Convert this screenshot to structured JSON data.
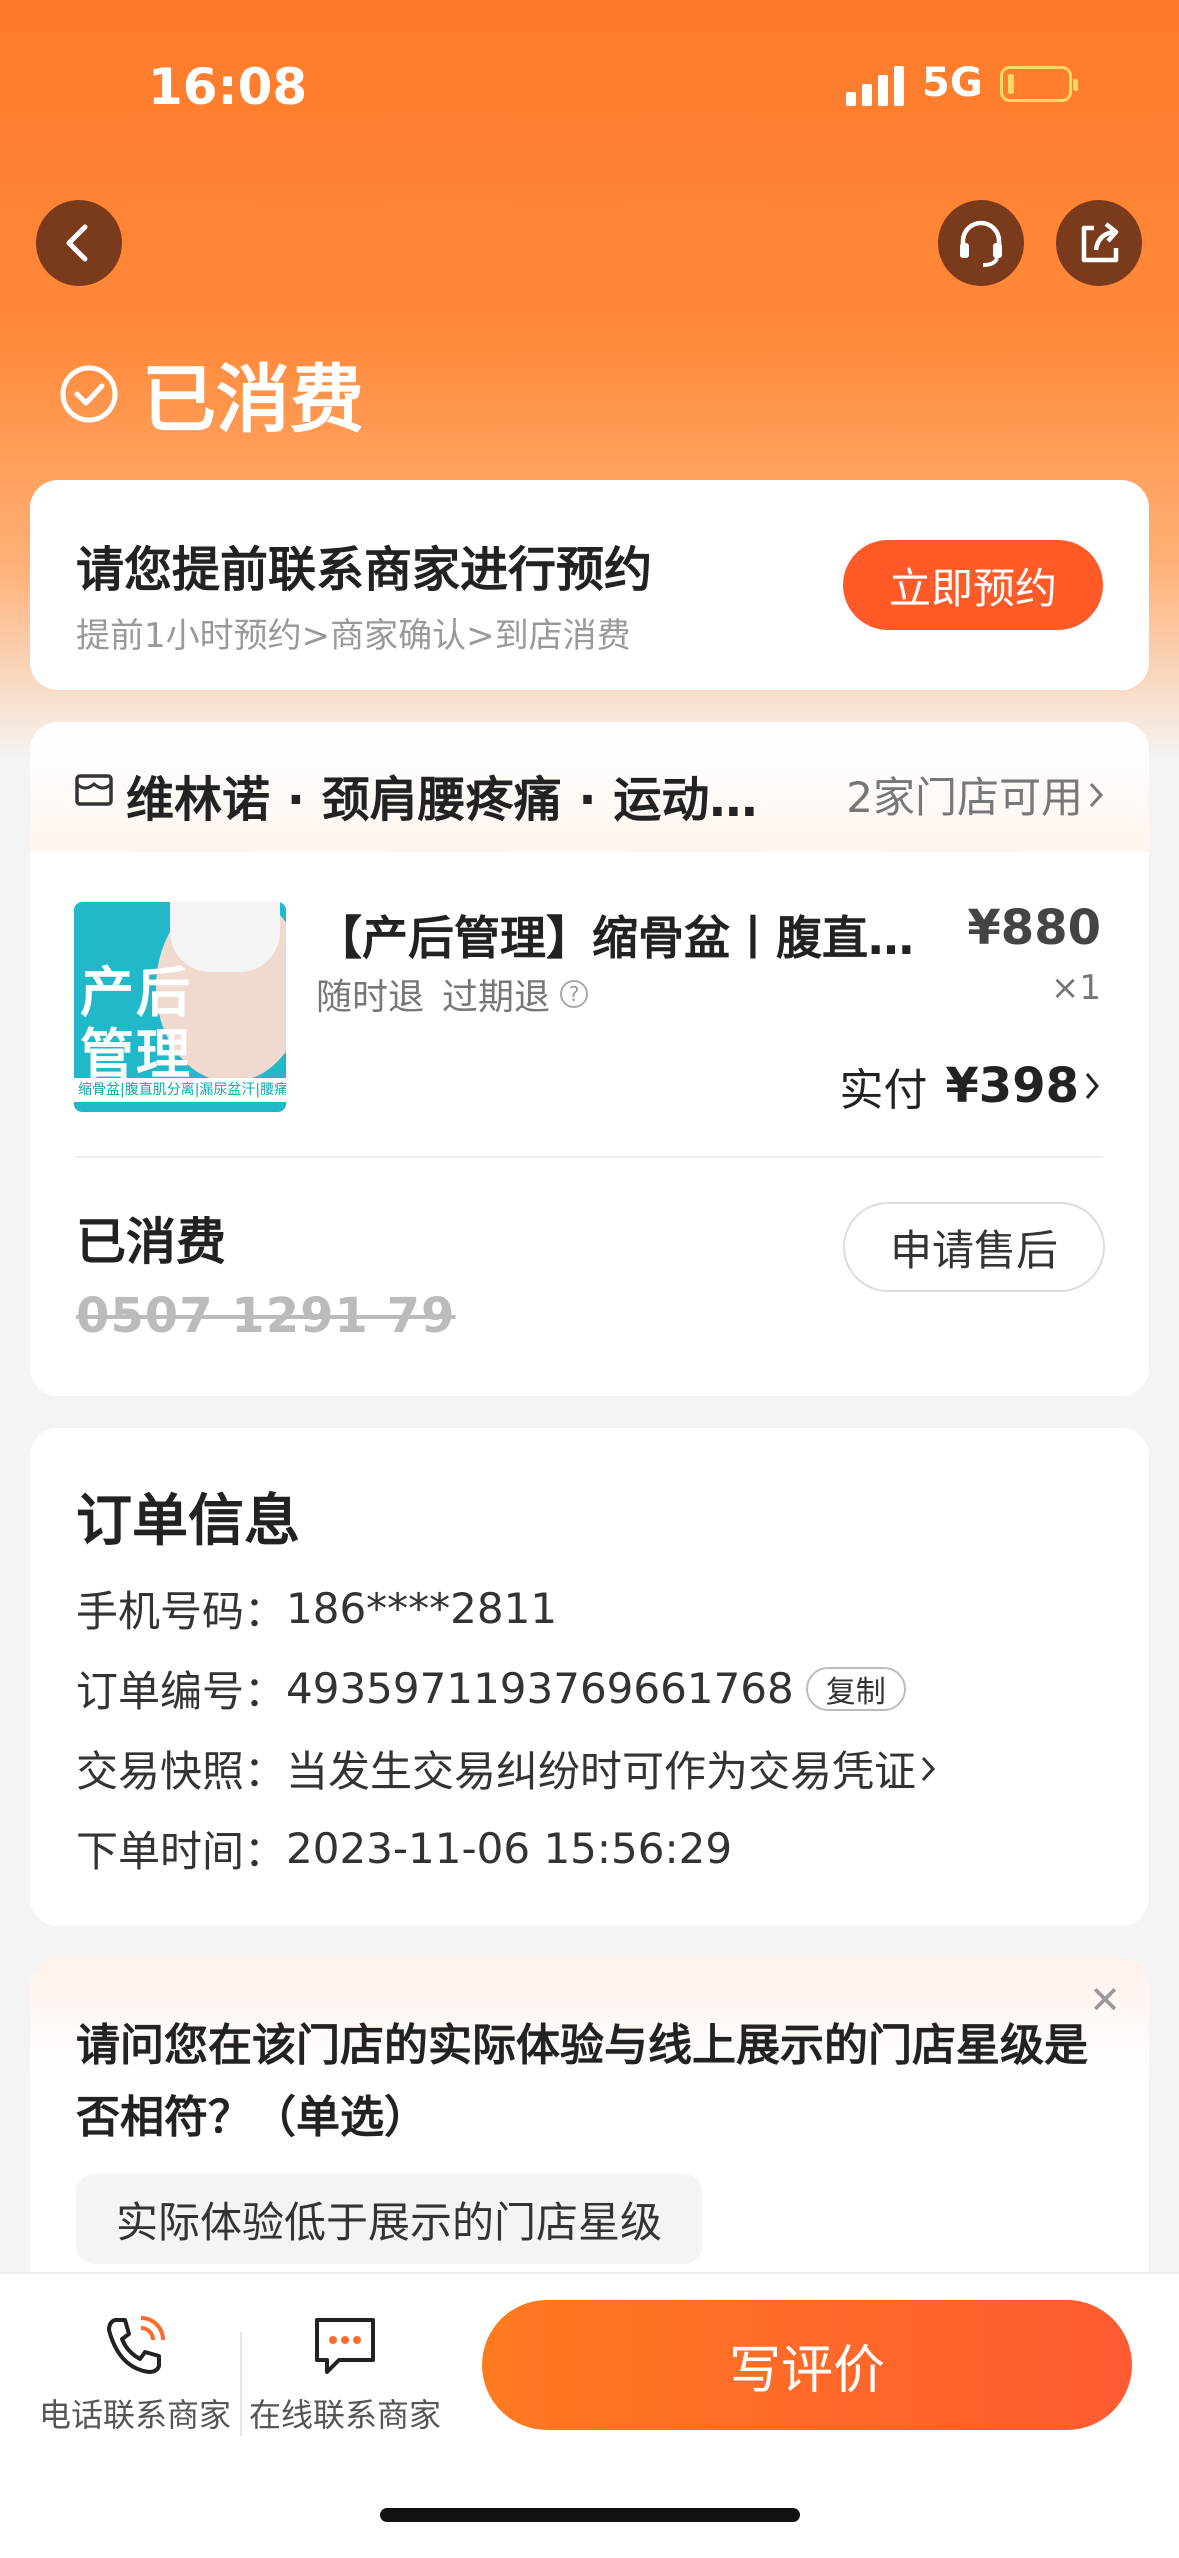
{
  "status_bar": {
    "time": "16:08",
    "network": "5G"
  },
  "header": {
    "status_title": "已消费"
  },
  "reserve": {
    "title": "请您提前联系商家进行预约",
    "steps": "提前1小时预约>商家确认>到店消费",
    "button": "立即预约"
  },
  "store": {
    "name": "维林诺 · 颈肩腰疼痛 · 运动…",
    "count": "2家门店可用"
  },
  "product": {
    "thumb_line1": "产后",
    "thumb_line2": "管理",
    "thumb_strip": "缩骨盆|腹直肌分离|漏尿盆汗|腰痛痛疼",
    "title": "【产后管理】缩骨盆丨腹直肌…",
    "tag_refund": "随时退",
    "tag_expire": "过期退",
    "price": "¥880",
    "qty": "×1",
    "paid_label": "实付",
    "paid_amount": "¥398"
  },
  "voucher": {
    "status": "已消费",
    "code": "0507 1291 79",
    "after_sale_button": "申请售后"
  },
  "order_info": {
    "title": "订单信息",
    "phone_label": "手机号码：",
    "phone": "186****2811",
    "order_no_label": "订单编号：",
    "order_no": "4935971193769661768",
    "copy_button": "复制",
    "snapshot_label": "交易快照：",
    "snapshot": "当发生交易纠纷时可作为交易凭证",
    "time_label": "下单时间：",
    "time": "2023-11-06 15:56:29"
  },
  "survey": {
    "question": "请问您在该门店的实际体验与线上展示的门店星级是否相符？（单选）",
    "option1": "实际体验低于展示的门店星级"
  },
  "bottom": {
    "phone_contact": "电话联系商家",
    "online_contact": "在线联系商家",
    "review_button": "写评价"
  },
  "colors": {
    "accent": "#ff5a28",
    "hero": "#ff7a2a"
  }
}
